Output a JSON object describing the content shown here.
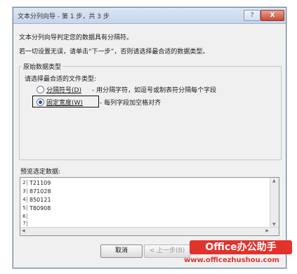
{
  "window": {
    "title": "文本分列向导 - 第 1 步，共 3 步",
    "help": "?",
    "close": "X"
  },
  "intro": {
    "line1": "文本分列向导判定您的数据具有分隔符。",
    "line2": "若一切设置无误，请单击“下一步”，否则请选择最合适的数据类型。"
  },
  "group": {
    "title": "原始数据类型",
    "prompt": "请选择最合适的文件类型:",
    "options": [
      {
        "label": "分隔符号(D)",
        "desc": "- 用分隔字符，如逗号或制表符分隔每个字段",
        "selected": false
      },
      {
        "label": "固定宽度(W)",
        "desc": "- 每列字段加空格对齐",
        "selected": true
      }
    ]
  },
  "preview": {
    "label": "预览选定数据:",
    "row_numbers": [
      "2",
      "3",
      "4",
      "5",
      "6",
      "7"
    ],
    "rows": [
      "T21109",
      "871028",
      "850121",
      "T80908",
      "",
      ""
    ]
  },
  "buttons": {
    "cancel": "取消",
    "back": "< 上一步(B)"
  },
  "watermark": {
    "brand": "Office办公助手",
    "url": "www.officezhushou.com"
  }
}
